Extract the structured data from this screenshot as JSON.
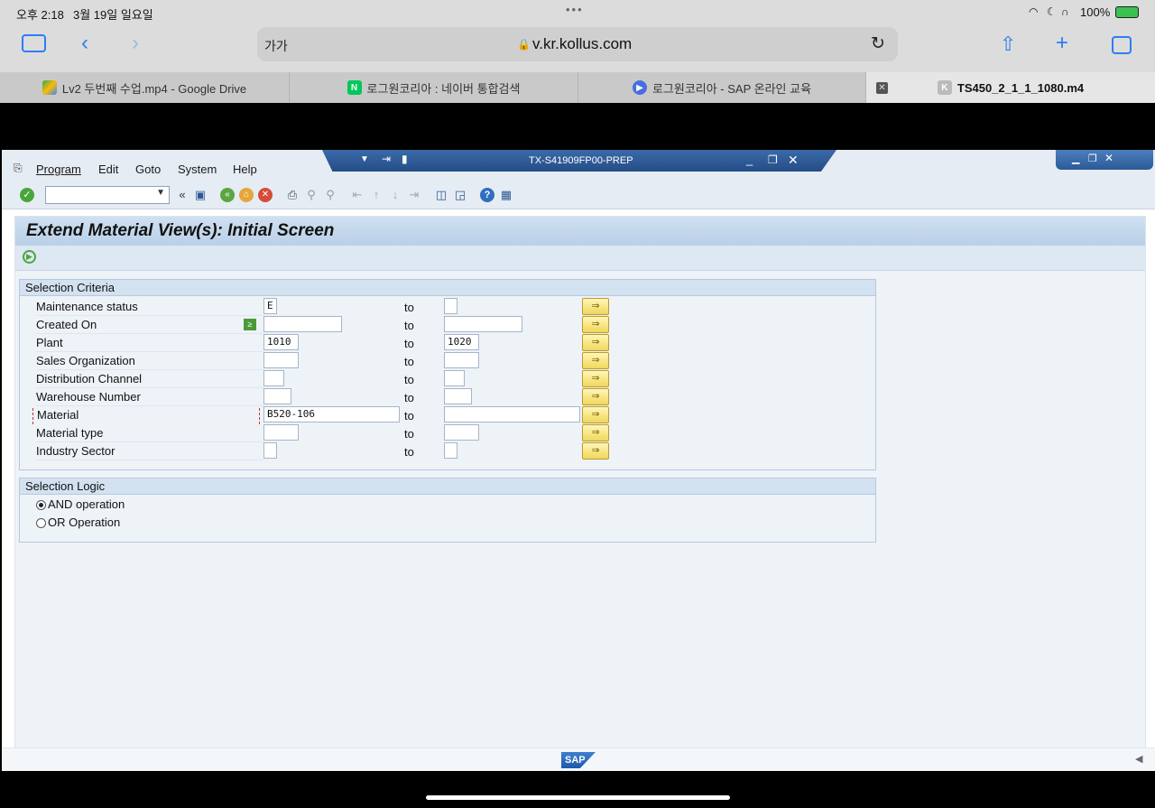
{
  "status": {
    "time": "오후 2:18",
    "date": "3월 19일 일요일",
    "dots": "•••",
    "battery": "100%"
  },
  "safari": {
    "text_size": "가가",
    "url": "v.kr.kollus.com"
  },
  "tabs": [
    {
      "label": "Lv2 두번째 수업.mp4 - Google Drive",
      "icon": "google-drive-icon"
    },
    {
      "label": "로그원코리아 : 네이버 통합검색",
      "icon": "naver-icon"
    },
    {
      "label": "로그원코리아 - SAP 온라인 교육",
      "icon": "play-icon"
    },
    {
      "label": "TS450_2_1_1_1080.m4",
      "icon": "k-icon"
    }
  ],
  "sap": {
    "menu": [
      "Program",
      "Edit",
      "Goto",
      "System",
      "Help"
    ],
    "system_title": "TX-S41909FP00-PREP",
    "title": "Extend Material View(s): Initial Screen",
    "selection_criteria": {
      "heading": "Selection Criteria",
      "to_label": "to",
      "rows": [
        {
          "label": "Maintenance status",
          "from": "E",
          "to": ""
        },
        {
          "label": "Created On",
          "from": "",
          "to": ""
        },
        {
          "label": "Plant",
          "from": "1010",
          "to": "1020"
        },
        {
          "label": "Sales Organization",
          "from": "",
          "to": ""
        },
        {
          "label": "Distribution Channel",
          "from": "",
          "to": ""
        },
        {
          "label": "Warehouse Number",
          "from": "",
          "to": ""
        },
        {
          "label": "Material",
          "from": "B520-106",
          "to": ""
        },
        {
          "label": "Material type",
          "from": "",
          "to": ""
        },
        {
          "label": "Industry Sector",
          "from": "",
          "to": ""
        }
      ]
    },
    "selection_logic": {
      "heading": "Selection Logic",
      "options": [
        {
          "label": "AND operation",
          "selected": true
        },
        {
          "label": "OR Operation",
          "selected": false
        }
      ]
    },
    "logo": "SAP"
  },
  "colors": {
    "sap_title_blue": "#244d86",
    "multi_select_yellow": "#f1d75a"
  }
}
